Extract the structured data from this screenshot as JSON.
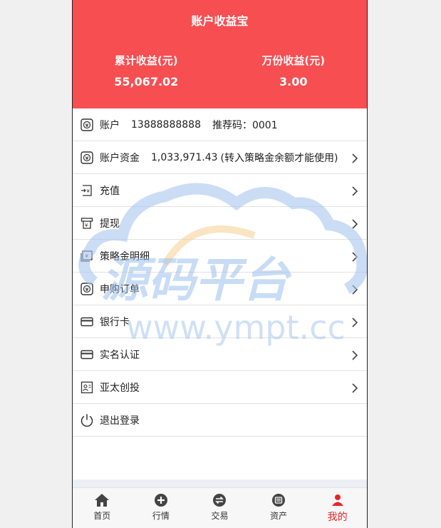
{
  "header": {
    "title": "账户收益宝",
    "stats": [
      {
        "label": "累计收益(元)",
        "value": "55,067.02"
      },
      {
        "label": "万份收益(元)",
        "value": "3.00"
      }
    ]
  },
  "account_row": {
    "label": "账户",
    "phone": "13888888888",
    "referral": "推荐码：0001"
  },
  "funds_row": {
    "label": "账户资金",
    "amount": "1,033,971.43",
    "note": "(转入策略金余额才能使用)"
  },
  "menu": [
    {
      "label": "充值",
      "icon": "recharge-icon"
    },
    {
      "label": "提现",
      "icon": "withdraw-icon"
    },
    {
      "label": "策略金明细",
      "icon": "strategy-detail-icon"
    },
    {
      "label": "申购订单",
      "icon": "order-icon"
    },
    {
      "label": "银行卡",
      "icon": "bank-card-icon"
    },
    {
      "label": "实名认证",
      "icon": "id-card-icon"
    },
    {
      "label": "亚太创投",
      "icon": "profile-icon"
    }
  ],
  "logout": {
    "label": "退出登录",
    "icon": "power-icon"
  },
  "tabs": [
    {
      "label": "首页",
      "icon": "home-icon"
    },
    {
      "label": "行情",
      "icon": "plus-circle-icon"
    },
    {
      "label": "交易",
      "icon": "swap-icon"
    },
    {
      "label": "资产",
      "icon": "list-circle-icon"
    },
    {
      "label": "我的",
      "icon": "user-icon",
      "active": true
    }
  ],
  "watermark": {
    "text": "源码平台",
    "url": "www.ympt.cc"
  },
  "colors": {
    "header_bg": "#f74e51",
    "active_tab": "#e8262a"
  }
}
